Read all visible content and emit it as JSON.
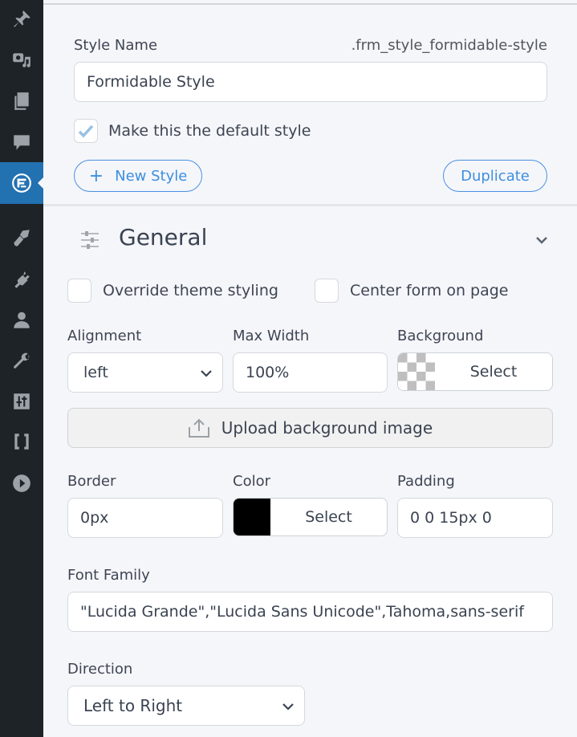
{
  "sidebar": {
    "items": [
      {
        "icon": "pin-icon",
        "active": false
      },
      {
        "icon": "media-icon",
        "active": false
      },
      {
        "icon": "pages-icon",
        "active": false
      },
      {
        "icon": "comments-icon",
        "active": false
      },
      {
        "icon": "formidable-icon",
        "active": true
      },
      {
        "icon": "appearance-brush-icon",
        "active": false
      },
      {
        "icon": "plugins-icon",
        "active": false
      },
      {
        "icon": "users-icon",
        "active": false
      },
      {
        "icon": "tools-wrench-icon",
        "active": false
      },
      {
        "icon": "settings-sliders-icon",
        "active": false
      },
      {
        "icon": "brackets-icon",
        "active": false
      },
      {
        "icon": "play-icon",
        "active": false
      }
    ],
    "active_color": "#2271b1"
  },
  "style_header": {
    "style_name_label": "Style Name",
    "class_name": ".frm_style_formidable-style",
    "style_name_value": "Formidable Style",
    "default_checkbox_label": "Make this the default style",
    "default_checked": true,
    "new_style_icon": "+",
    "new_style_label": "New Style",
    "duplicate_label": "Duplicate"
  },
  "general": {
    "title": "General",
    "override_label": "Override theme styling",
    "override_checked": false,
    "center_label": "Center form on page",
    "center_checked": false,
    "alignment_label": "Alignment",
    "alignment_value": "left",
    "max_width_label": "Max Width",
    "max_width_value": "100%",
    "background_label": "Background",
    "background_select": "Select",
    "upload_label": "Upload background image",
    "border_label": "Border",
    "border_value": "0px",
    "color_label": "Color",
    "color_select": "Select",
    "color_value": "#000000",
    "padding_label": "Padding",
    "padding_value": "0 0 15px 0",
    "font_family_label": "Font Family",
    "font_family_value": "\"Lucida Grande\",\"Lucida Sans Unicode\",Tahoma,sans-serif",
    "direction_label": "Direction",
    "direction_value": "Left to Right"
  },
  "colors": {
    "accent": "#4a90e2",
    "sidebar_bg": "#1d2327"
  }
}
